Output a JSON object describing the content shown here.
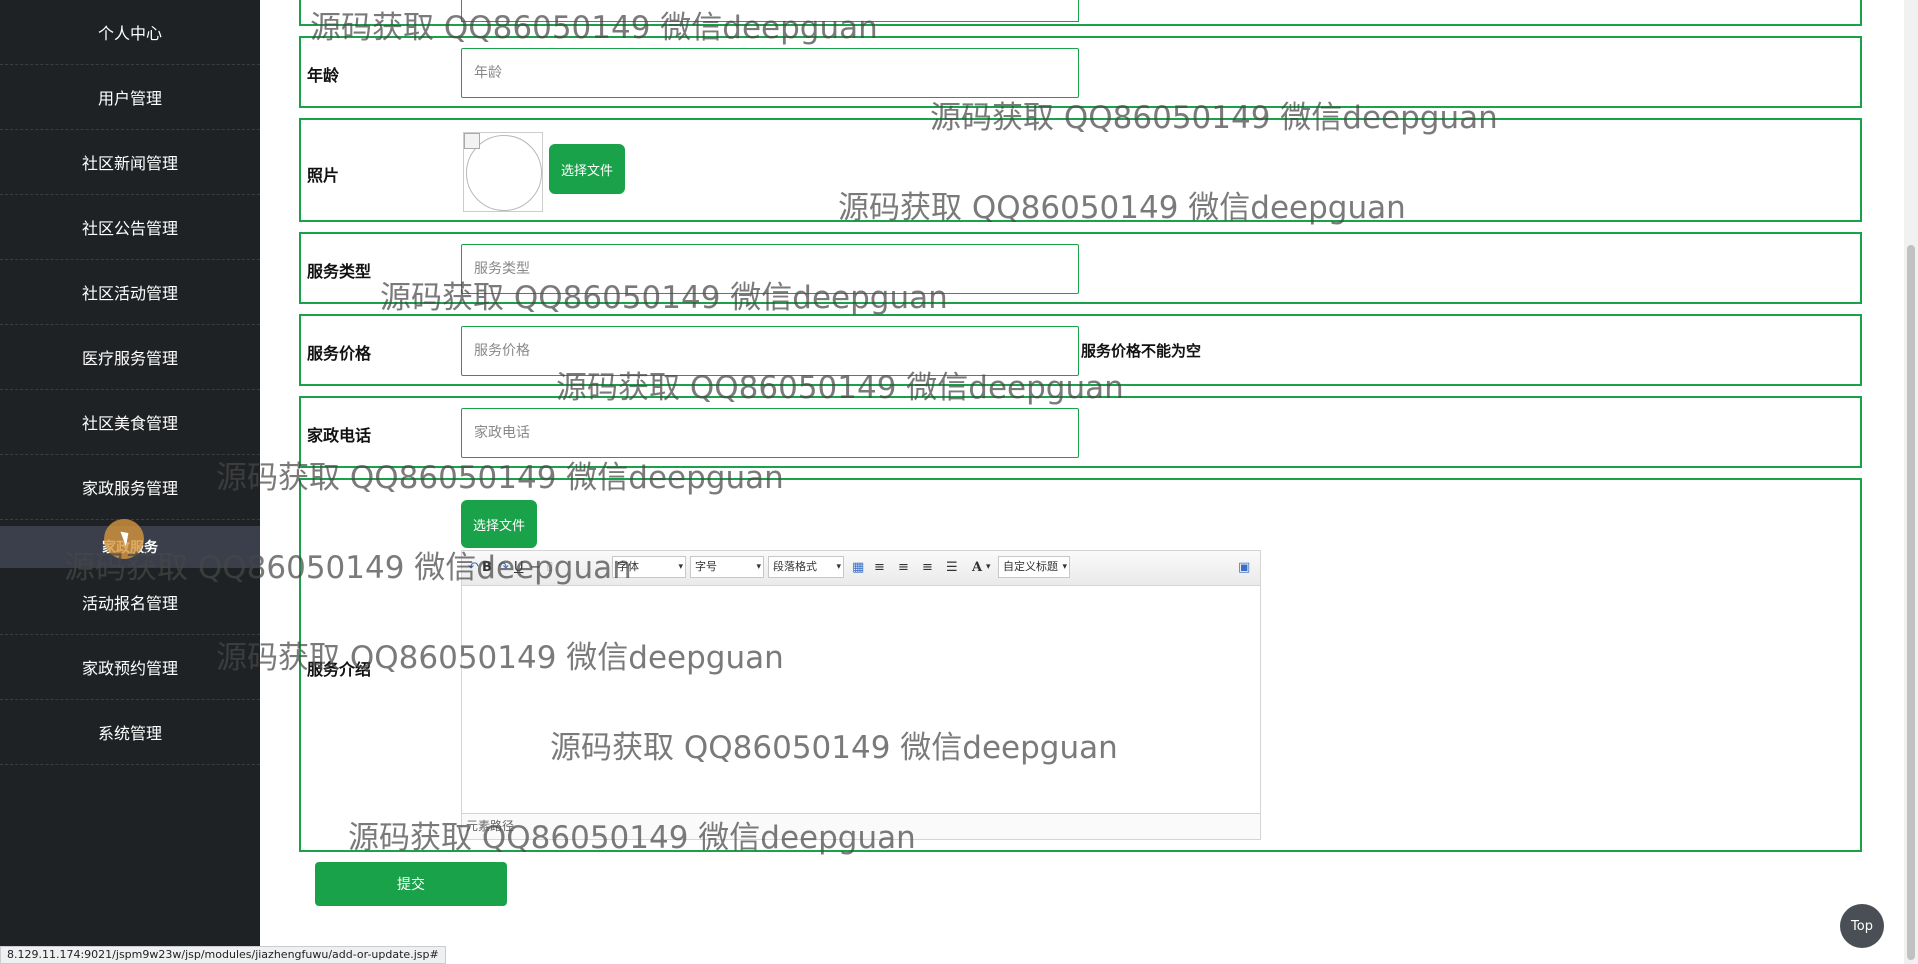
{
  "sidebar": {
    "items": [
      {
        "label": "个人中心"
      },
      {
        "label": "用户管理"
      },
      {
        "label": "社区新闻管理"
      },
      {
        "label": "社区公告管理"
      },
      {
        "label": "社区活动管理"
      },
      {
        "label": "医疗服务管理"
      },
      {
        "label": "社区美食管理"
      },
      {
        "label": "家政服务管理"
      },
      {
        "label": "家政服务"
      },
      {
        "label": "活动报名管理"
      },
      {
        "label": "家政预约管理"
      },
      {
        "label": "系统管理"
      }
    ],
    "active_index": 8
  },
  "form": {
    "age": {
      "label": "年龄",
      "placeholder": "年龄"
    },
    "photo": {
      "label": "照片",
      "button": "选择文件"
    },
    "service_type": {
      "label": "服务类型",
      "placeholder": "服务类型"
    },
    "service_price": {
      "label": "服务价格",
      "placeholder": "服务价格",
      "error": "服务价格不能为空"
    },
    "phone": {
      "label": "家政电话",
      "placeholder": "家政电话"
    },
    "intro": {
      "label": "服务介绍",
      "button": "选择文件",
      "toolbar": {
        "font": "字体",
        "font_size": "字号",
        "paragraph": "段落格式",
        "custom_title": "自定义标题",
        "bold": "B",
        "font_color": "A"
      },
      "status": "元素路径"
    },
    "submit": "提交"
  },
  "watermark_text": "源码获取 QQ86050149 微信deepguan",
  "status_url": "8.129.11.174:9021/jspm9w23w/jsp/modules/jiazhengfuwu/add-or-update.jsp#",
  "top_button": "Top",
  "colors": {
    "sidebar_bg": "#1f2224",
    "accent_green": "#1aa24a",
    "active_item_bg": "#3a3f4b"
  }
}
